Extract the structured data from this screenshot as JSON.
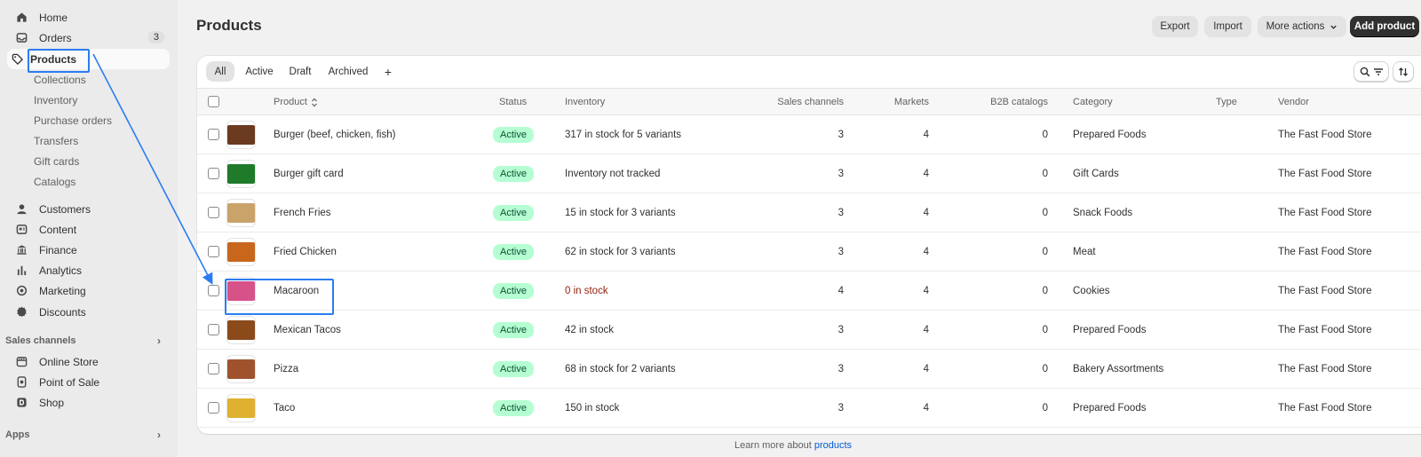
{
  "sidebar": {
    "main": [
      {
        "label": "Home",
        "icon": "home-icon"
      },
      {
        "label": "Orders",
        "icon": "inbox-icon",
        "badge": "3"
      },
      {
        "label": "Products",
        "icon": "tag-icon",
        "active": true
      }
    ],
    "products_sub": [
      "Collections",
      "Inventory",
      "Purchase orders",
      "Transfers",
      "Gift cards",
      "Catalogs"
    ],
    "more": [
      {
        "label": "Customers",
        "icon": "person-icon"
      },
      {
        "label": "Content",
        "icon": "content-icon"
      },
      {
        "label": "Finance",
        "icon": "bank-icon"
      },
      {
        "label": "Analytics",
        "icon": "chart-icon"
      },
      {
        "label": "Marketing",
        "icon": "target-icon"
      },
      {
        "label": "Discounts",
        "icon": "discount-icon"
      }
    ],
    "sales_channels_label": "Sales channels",
    "channels": [
      {
        "label": "Online Store",
        "icon": "store-icon"
      },
      {
        "label": "Point of Sale",
        "icon": "pos-icon"
      },
      {
        "label": "Shop",
        "icon": "shop-icon"
      }
    ],
    "apps_label": "Apps"
  },
  "header": {
    "title": "Products",
    "export_label": "Export",
    "import_label": "Import",
    "more_actions_label": "More actions",
    "add_product_label": "Add product"
  },
  "tabs": [
    "All",
    "Active",
    "Draft",
    "Archived"
  ],
  "add_tab_symbol": "+",
  "columns": {
    "product": "Product",
    "status": "Status",
    "inventory": "Inventory",
    "sales_channels": "Sales channels",
    "markets": "Markets",
    "b2b": "B2B catalogs",
    "category": "Category",
    "type": "Type",
    "vendor": "Vendor"
  },
  "products": [
    {
      "name": "Burger (beef, chicken, fish)",
      "status": "Active",
      "inventory": "317 in stock for 5 variants",
      "channels": "3",
      "markets": "4",
      "b2b": "0",
      "category": "Prepared Foods",
      "vendor": "The Fast Food Store",
      "thumb_color": "#6b3a1f"
    },
    {
      "name": "Burger gift card",
      "status": "Active",
      "inventory": "Inventory not tracked",
      "channels": "3",
      "markets": "4",
      "b2b": "0",
      "category": "Gift Cards",
      "vendor": "The Fast Food Store",
      "thumb_color": "#1f7a2a"
    },
    {
      "name": "French Fries",
      "status": "Active",
      "inventory": "15 in stock for 3 variants",
      "channels": "3",
      "markets": "4",
      "b2b": "0",
      "category": "Snack Foods",
      "vendor": "The Fast Food Store",
      "thumb_color": "#c9a36a"
    },
    {
      "name": "Fried Chicken",
      "status": "Active",
      "inventory": "62 in stock for 3 variants",
      "channels": "3",
      "markets": "4",
      "b2b": "0",
      "category": "Meat",
      "vendor": "The Fast Food Store",
      "thumb_color": "#c8661c"
    },
    {
      "name": "Macaroon",
      "status": "Active",
      "inventory": "0 in stock",
      "inventory_low": true,
      "channels": "4",
      "markets": "4",
      "b2b": "0",
      "category": "Cookies",
      "vendor": "The Fast Food Store",
      "thumb_color": "#d8528a"
    },
    {
      "name": "Mexican Tacos",
      "status": "Active",
      "inventory": "42 in stock",
      "channels": "3",
      "markets": "4",
      "b2b": "0",
      "category": "Prepared Foods",
      "vendor": "The Fast Food Store",
      "thumb_color": "#8b4a1a"
    },
    {
      "name": "Pizza",
      "status": "Active",
      "inventory": "68 in stock for 2 variants",
      "channels": "3",
      "markets": "4",
      "b2b": "0",
      "category": "Bakery Assortments",
      "vendor": "The Fast Food Store",
      "thumb_color": "#a0522d"
    },
    {
      "name": "Taco",
      "status": "Active",
      "inventory": "150 in stock",
      "channels": "3",
      "markets": "4",
      "b2b": "0",
      "category": "Prepared Foods",
      "vendor": "The Fast Food Store",
      "thumb_color": "#e0b030"
    }
  ],
  "footer": {
    "prefix": "Learn more about ",
    "link": "products"
  },
  "colors": {
    "highlight": "#2b7cf2",
    "active_badge_bg": "#b4fed2",
    "active_badge_text": "#0c5132",
    "low_stock": "#8e1f0b"
  }
}
